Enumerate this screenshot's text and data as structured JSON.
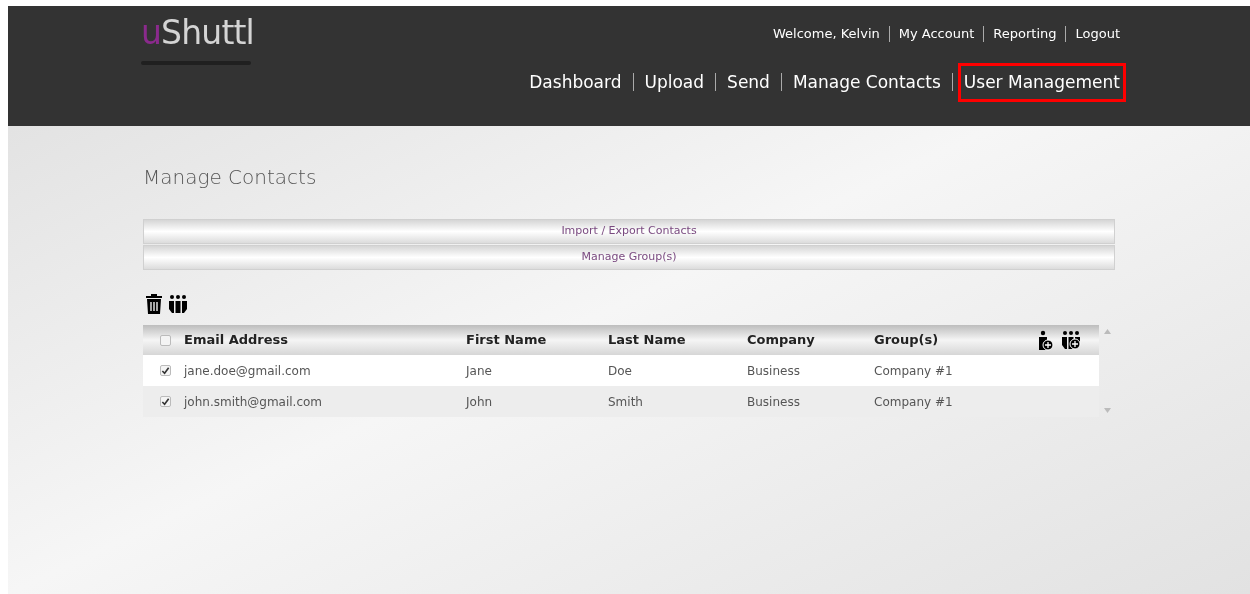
{
  "logo": {
    "accent": "u",
    "rest": "Shuttl"
  },
  "top_links": [
    "Welcome, Kelvin",
    "My Account",
    "Reporting",
    "Logout"
  ],
  "nav": [
    {
      "label": "Dashboard",
      "highlighted": false
    },
    {
      "label": "Upload",
      "highlighted": false
    },
    {
      "label": "Send",
      "highlighted": false
    },
    {
      "label": "Manage Contacts",
      "highlighted": false
    },
    {
      "label": "User Management",
      "highlighted": true
    }
  ],
  "page_title": "Manage Contacts",
  "panels": [
    "Import / Export Contacts",
    "Manage Group(s)"
  ],
  "table": {
    "select_all_checked": false,
    "columns": [
      "Email Address",
      "First Name",
      "Last Name",
      "Company",
      "Group(s)"
    ],
    "rows": [
      {
        "checked": true,
        "cells": [
          "jane.doe@gmail.com",
          "Jane",
          "Doe",
          "Business",
          "Company #1"
        ]
      },
      {
        "checked": true,
        "cells": [
          "john.smith@gmail.com",
          "John",
          "Smith",
          "Business",
          "Company #1"
        ]
      }
    ]
  }
}
